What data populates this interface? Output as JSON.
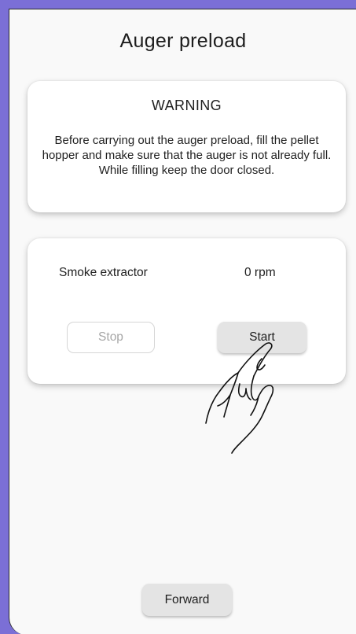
{
  "page": {
    "title": "Auger preload"
  },
  "warning": {
    "title": "WARNING",
    "text": "Before carrying out the auger preload, fill the pellet hopper and make sure that the auger is not already full. While filling keep the door closed."
  },
  "controls": {
    "label": "Smoke extractor",
    "value": "0 rpm",
    "stop_label": "Stop",
    "start_label": "Start"
  },
  "footer": {
    "forward_label": "Forward"
  },
  "icons": {
    "pointer": "pointing-hand-icon"
  },
  "colors": {
    "accent": "#7b6fd6",
    "background": "#f9f9f9",
    "card": "#ffffff",
    "button": "#e4e4e4",
    "disabled_text": "#a6a6a6"
  }
}
